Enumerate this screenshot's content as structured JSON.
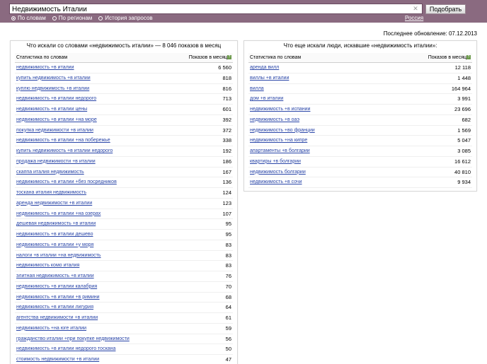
{
  "search": {
    "value": "Недвижимость Италии"
  },
  "button": {
    "label": "Подобрать"
  },
  "modes": [
    {
      "label": "По словам",
      "selected": true
    },
    {
      "label": "По регионам",
      "selected": false
    },
    {
      "label": "История запросов",
      "selected": false
    }
  ],
  "region": "Россия",
  "updated": "Последнее обновление: 07.12.2013",
  "left": {
    "title": "Что искали со словами «недвижимость италии» — 8 046 показов в месяц",
    "col_words": "Статистика по словам",
    "col_shows": "Показов в месяц",
    "rows": [
      {
        "q": "недвижимость +в италии",
        "n": "6 560"
      },
      {
        "q": "купить недвижимость +в италии",
        "n": "818"
      },
      {
        "q": "куплю недвижимость +в италии",
        "n": "816"
      },
      {
        "q": "недвижимость +в италии недорого",
        "n": "713"
      },
      {
        "q": "недвижимость +в италии цены",
        "n": "601"
      },
      {
        "q": "недвижимость +в италии +на море",
        "n": "392"
      },
      {
        "q": "покупка недвижимости +в италии",
        "n": "372"
      },
      {
        "q": "недвижимость +в италии +на побережье",
        "n": "338"
      },
      {
        "q": "купить недвижимость +в италии недорого",
        "n": "192"
      },
      {
        "q": "продажа недвижимости +в италии",
        "n": "186"
      },
      {
        "q": "скаппа италия недвижимость",
        "n": "167"
      },
      {
        "q": "недвижимость +в италии +без посредников",
        "n": "136"
      },
      {
        "q": "тоскана италия недвижимость",
        "n": "124"
      },
      {
        "q": "аренда недвижимости +в италии",
        "n": "123"
      },
      {
        "q": "недвижимость +в италии +на озерах",
        "n": "107"
      },
      {
        "q": "дешевая недвижимость +в италии",
        "n": "95"
      },
      {
        "q": "недвижимость +в италии дешево",
        "n": "95"
      },
      {
        "q": "недвижимость +в италии +у моря",
        "n": "83"
      },
      {
        "q": "налоги +в италии +на недвижимость",
        "n": "83"
      },
      {
        "q": "недвижимость комо италия",
        "n": "83"
      },
      {
        "q": "элитная недвижимость +в италии",
        "n": "76"
      },
      {
        "q": "недвижимость +в италии калабрия",
        "n": "70"
      },
      {
        "q": "недвижимость +в италии +в римини",
        "n": "68"
      },
      {
        "q": "недвижимость +в италии лигурия",
        "n": "64"
      },
      {
        "q": "агентства недвижимости +в италии",
        "n": "61"
      },
      {
        "q": "недвижимость +на юге италии",
        "n": "59"
      },
      {
        "q": "гражданство италии +при покупке недвижимости",
        "n": "56"
      },
      {
        "q": "недвижимость +в италии недорого тоскана",
        "n": "50"
      },
      {
        "q": "стоимость недвижимости +в италии",
        "n": "47"
      }
    ]
  },
  "right": {
    "title": "Что еще искали люди, искавшие «недвижимость италии»:",
    "col_words": "Статистика по словам",
    "col_shows": "Показов в месяц",
    "rows": [
      {
        "q": "аренда вилл",
        "n": "12 118"
      },
      {
        "q": "виллы +в италии",
        "n": "1 448"
      },
      {
        "q": "вилла",
        "n": "164 964"
      },
      {
        "q": "дом +в италии",
        "n": "3 991"
      },
      {
        "q": "недвижимость +в испании",
        "n": "23 696"
      },
      {
        "q": "недвижимость +в оаэ",
        "n": "682"
      },
      {
        "q": "недвижимость +во франции",
        "n": "1 569"
      },
      {
        "q": "недвижимость +на кипре",
        "n": "5 047"
      },
      {
        "q": "апартаменты +в болгарии",
        "n": "3 085"
      },
      {
        "q": "квартиры +в болгарии",
        "n": "16 612"
      },
      {
        "q": "недвижимость болгарии",
        "n": "40 810"
      },
      {
        "q": "недвижимость +в сочи",
        "n": "9 934"
      }
    ]
  },
  "colors": {
    "header": "#8a6a80",
    "link": "#2a46a8"
  },
  "icons": {
    "clear": "close-icon",
    "help": "help-icon"
  }
}
